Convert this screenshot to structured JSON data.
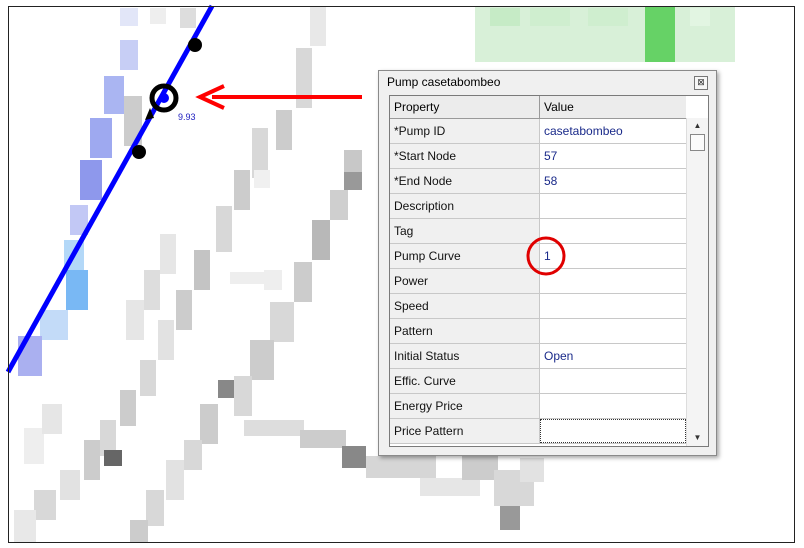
{
  "map": {
    "pump_label": "9.93",
    "pipe_color": "#0000ff",
    "pump_color": "#0000ff",
    "arrow_color": "#ff0000"
  },
  "dialog": {
    "title": "Pump casetabombeo",
    "close_glyph": "⊠",
    "header": {
      "property": "Property",
      "value": "Value"
    },
    "rows": [
      {
        "property": "*Pump ID",
        "value": "casetabombeo"
      },
      {
        "property": "*Start Node",
        "value": "57"
      },
      {
        "property": "*End Node",
        "value": "58"
      },
      {
        "property": "Description",
        "value": ""
      },
      {
        "property": "Tag",
        "value": ""
      },
      {
        "property": "Pump Curve",
        "value": "1"
      },
      {
        "property": "Power",
        "value": ""
      },
      {
        "property": "Speed",
        "value": ""
      },
      {
        "property": "Pattern",
        "value": ""
      },
      {
        "property": "Initial Status",
        "value": "Open"
      },
      {
        "property": "Effic. Curve",
        "value": ""
      },
      {
        "property": "Energy Price",
        "value": ""
      },
      {
        "property": "Price Pattern",
        "value": ""
      }
    ],
    "scroll_up_glyph": "▲",
    "scroll_down_glyph": "▼",
    "highlight_color": "#e00000"
  }
}
